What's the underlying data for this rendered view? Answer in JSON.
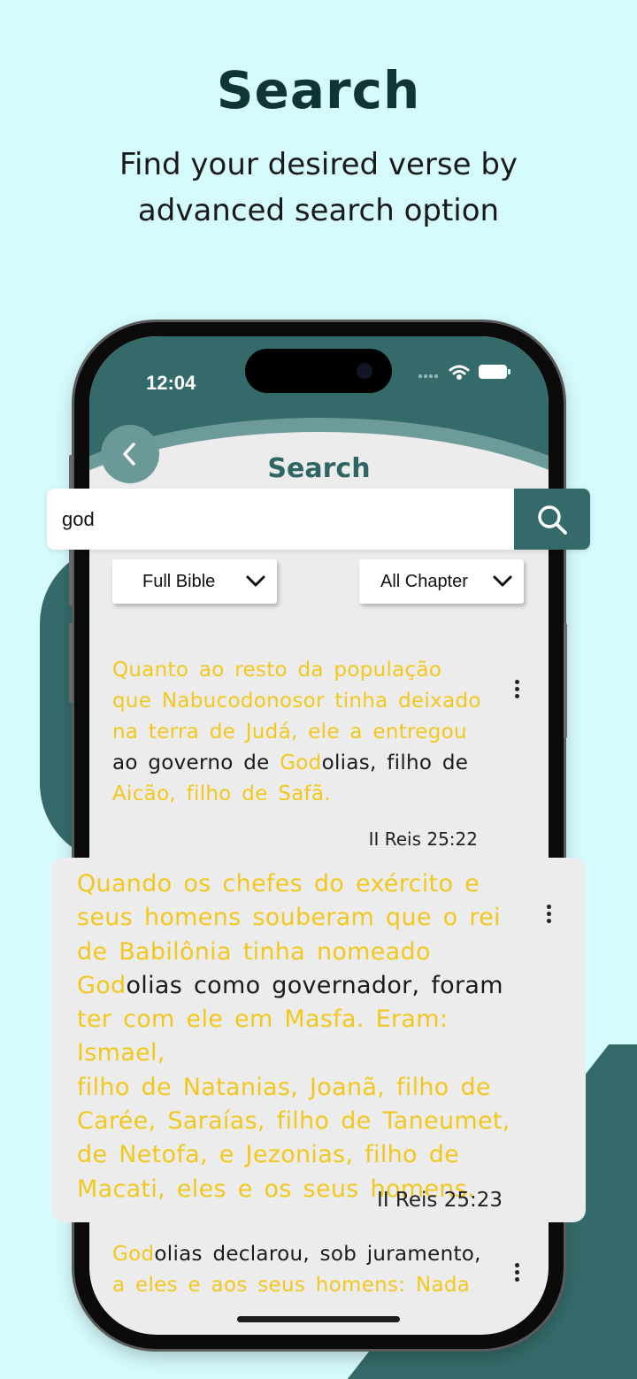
{
  "promo": {
    "title": "Search",
    "subtitle_line1": "Find your desired verse by",
    "subtitle_line2": "advanced search option"
  },
  "status_bar": {
    "time": "12:04"
  },
  "screen": {
    "title": "Search",
    "search": {
      "value": "god",
      "placeholder": ""
    },
    "filters": {
      "book": "Full Bible",
      "chapter": "All Chapter"
    }
  },
  "results": [
    {
      "lines": [
        [
          "",
          "Quanto ao resto da população",
          ""
        ],
        [
          "",
          "que Nabucodonosor tinha deixado",
          ""
        ],
        [
          "",
          "na terra de Judá, ele a entregou",
          ""
        ],
        [
          "ao governo de ",
          "God",
          "olias, filho de"
        ],
        [
          "",
          "Aicão, filho de Safã.",
          ""
        ]
      ],
      "reference": "II Reis 25:22"
    },
    {
      "lines": [
        [
          "",
          "Quando os chefes do exército e",
          ""
        ],
        [
          "",
          "seus homens souberam que o rei",
          ""
        ],
        [
          "",
          "de Babilônia tinha nomeado",
          ""
        ],
        [
          "",
          "God",
          "olias como governador, foram"
        ],
        [
          "",
          "ter com ele em Masfa. Eram: Ismael,",
          ""
        ],
        [
          "",
          "filho de Natanias, Joanã, filho de",
          ""
        ],
        [
          "",
          "Carée, Saraías, filho de Taneumet,",
          ""
        ],
        [
          "",
          "de Netofa, e Jezonias, filho de",
          ""
        ],
        [
          "",
          "Macati, eles e os seus homens.",
          ""
        ]
      ],
      "reference": "II Reis 25:23"
    },
    {
      "lines": [
        [
          "",
          "God",
          "olias declarou, sob juramento,"
        ],
        [
          "",
          "a eles e aos seus homens: Nada",
          ""
        ]
      ],
      "reference": ""
    }
  ],
  "colors": {
    "background": "#d6fbfd",
    "brand": "#346b6a",
    "highlight": "#f2c81e",
    "title": "#0f3536"
  },
  "icons": {
    "back": "chevron-left-icon",
    "search": "magnifier-icon",
    "dropdown": "chevron-down-icon",
    "more": "kebab-icon"
  }
}
